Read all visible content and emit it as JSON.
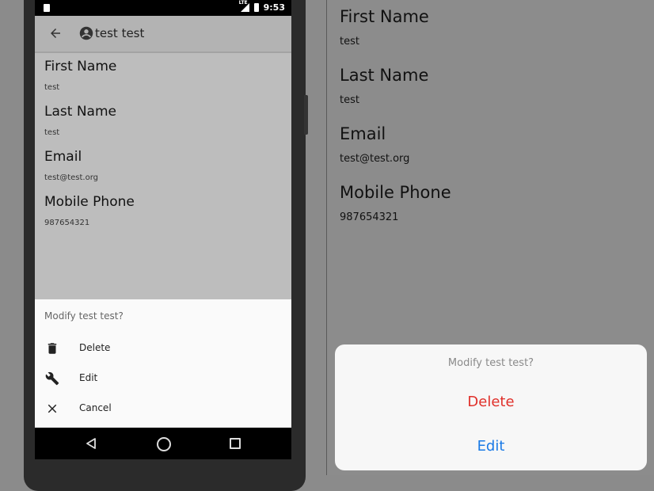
{
  "android": {
    "status_bar": {
      "time": "9:53",
      "network": "LTE"
    },
    "app_bar": {
      "title": "test test",
      "back_icon": "arrow-back-icon",
      "title_icon": "account-circle-icon"
    },
    "fields": [
      {
        "label": "First Name",
        "value": "test"
      },
      {
        "label": "Last Name",
        "value": "test"
      },
      {
        "label": "Email",
        "value": "test@test.org"
      },
      {
        "label": "Mobile Phone",
        "value": "987654321"
      }
    ],
    "action_sheet": {
      "title": "Modify test test?",
      "items": [
        {
          "icon": "trash-icon",
          "label": "Delete"
        },
        {
          "icon": "wrench-icon",
          "label": "Edit"
        },
        {
          "icon": "close-icon",
          "label": "Cancel"
        }
      ]
    },
    "nav_bar": {
      "icons": [
        "nav-back-icon",
        "nav-home-icon",
        "nav-recents-icon"
      ]
    }
  },
  "ios": {
    "fields": [
      {
        "label": "First Name",
        "value": "test"
      },
      {
        "label": "Last Name",
        "value": "test"
      },
      {
        "label": "Email",
        "value": "test@test.org"
      },
      {
        "label": "Mobile Phone",
        "value": "987654321"
      }
    ],
    "action_sheet": {
      "title": "Modify test test?",
      "delete_label": "Delete",
      "edit_label": "Edit",
      "delete_color": "#e0302a",
      "edit_color": "#1a7ae6"
    }
  }
}
